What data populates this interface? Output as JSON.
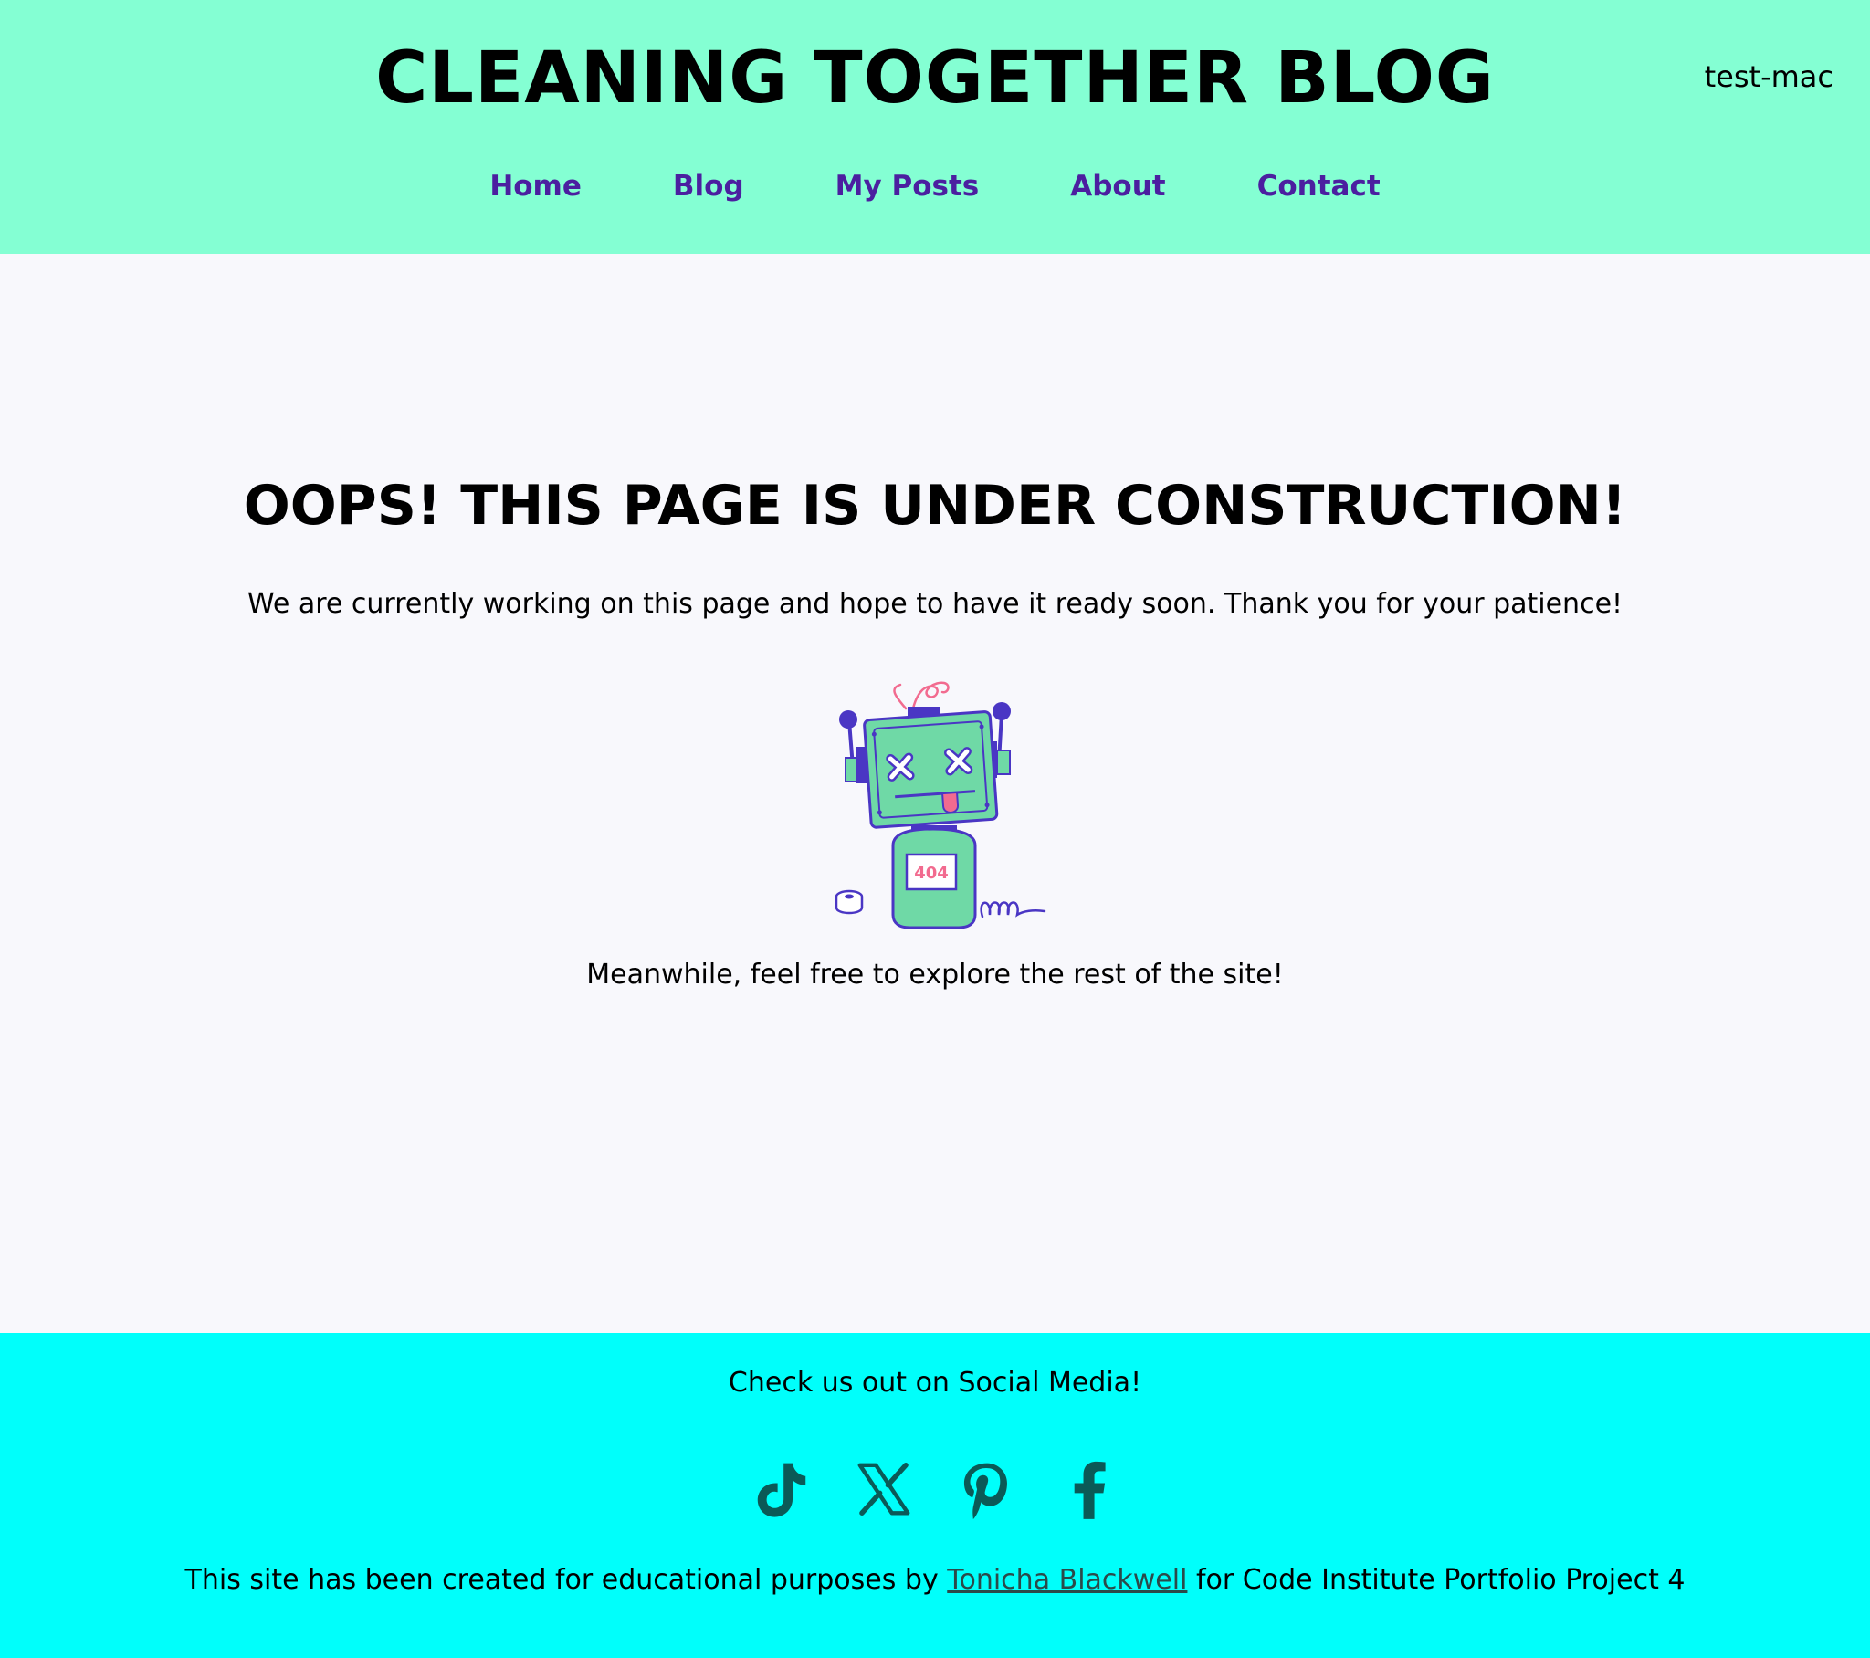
{
  "header": {
    "site_title": "CLEANING TOGETHER BLOG",
    "user": "test-mac",
    "nav": [
      {
        "label": "Home"
      },
      {
        "label": "Blog"
      },
      {
        "label": "My Posts"
      },
      {
        "label": "About"
      },
      {
        "label": "Contact"
      }
    ]
  },
  "main": {
    "heading": "OOPS! THIS PAGE IS UNDER CONSTRUCTION!",
    "intro": "We are currently working on this page and hope to have it ready soon. Thank you for your patience!",
    "robot_badge": "404",
    "explore": "Meanwhile, feel free to explore the rest of the site!"
  },
  "footer": {
    "social_heading": "Check us out on Social Media!",
    "social_icons": [
      "tiktok-icon",
      "x-icon",
      "pinterest-icon",
      "facebook-icon"
    ],
    "credit_prefix": "This site has been created for educational purposes by",
    "credit_link": "Tonicha Blackwell",
    "credit_suffix": "for Code Institute Portfolio Project 4"
  },
  "colors": {
    "header_bg": "#84ffd3",
    "nav_link": "#4b1fa0",
    "page_bg": "#f8f8fc",
    "footer_bg": "#00fffb",
    "icon": "#0b5a57",
    "robot_body": "#6fd9a6",
    "robot_outline": "#4a36c4",
    "robot_accent": "#f26b8f"
  }
}
